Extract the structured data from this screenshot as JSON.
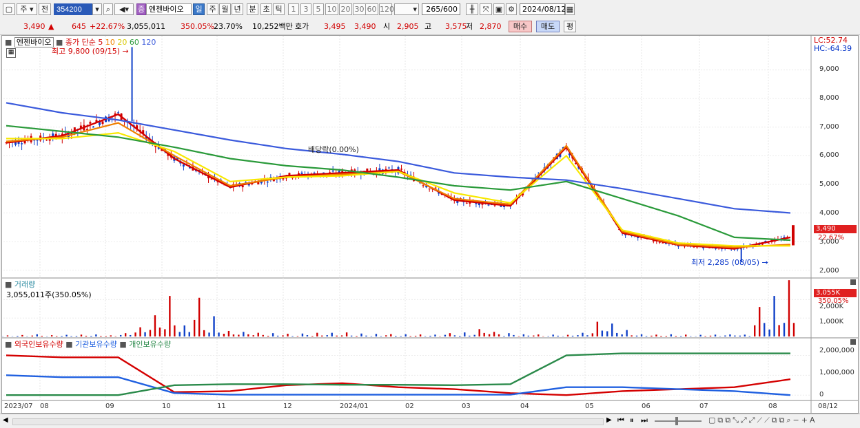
{
  "toolbar": {
    "market": "주",
    "prev": "전",
    "code": "354200",
    "stock_badge": "증",
    "stock_name": "엔젠바이오",
    "periods": [
      "일",
      "주",
      "월",
      "년",
      "분",
      "초",
      "틱"
    ],
    "intervals": [
      "1",
      "3",
      "5",
      "10",
      "20",
      "30",
      "60",
      "120"
    ],
    "count": "265",
    "count_total": "/600",
    "date": "2024/08/12"
  },
  "quote": {
    "price": "3,490",
    "change": "645",
    "change_pct": "+22.67%",
    "volume": "3,055,011",
    "volume_ratio": "350.05%",
    "turnover": "23.70%",
    "amount": "10,252백만",
    "bid_label": "호가",
    "ask": "3,495",
    "bid": "3,490",
    "open_label": "시",
    "open": "2,905",
    "high_label": "고",
    "high": "3,575",
    "low_label": "저",
    "low": "2,870",
    "buy_btn": "매수",
    "sell_btn": "매도",
    "eval_btn": "평"
  },
  "price_panel": {
    "name": "엔젠바이오",
    "legend_prefix": "종가 단순",
    "ma_periods": [
      "5",
      "10",
      "20",
      "60",
      "120"
    ],
    "lc": "LC:52.74",
    "hc": "HC:-64.39",
    "high_note": "최고 9,800 (09/15)",
    "low_note": "최저 2,285 (08/05)",
    "dividend_note": "배당락(0.00%)",
    "last_price": "3,490",
    "last_pct": "22.67%",
    "y_ticks": [
      "9,000",
      "8,000",
      "7,000",
      "6,000",
      "5,000",
      "4,000",
      "3,000",
      "2,000"
    ]
  },
  "volume_panel": {
    "title": "거래량",
    "value": "3,055,011주(350.05%)",
    "last_value": "3,055K",
    "last_pct": "350.05%",
    "y_ticks": [
      "2,000K",
      "1,000K"
    ]
  },
  "holding_panel": {
    "legend": [
      "외국인보유수량",
      "기관보유수량",
      "개인보유수량"
    ],
    "y_ticks": [
      "2,000,000",
      "1,000,000",
      "0"
    ]
  },
  "x_labels": [
    "2023/07",
    "08",
    "09",
    "10",
    "11",
    "12",
    "2024/01",
    "02",
    "03",
    "04",
    "05",
    "06",
    "07",
    "08",
    "08/12"
  ],
  "colors": {
    "ma5": "#d40000",
    "ma10": "#f08000",
    "ma20": "#f8e800",
    "ma60": "#2a9a3a",
    "ma120": "#3a5adc",
    "up": "#d00000",
    "down": "#1040c8",
    "foreign": "#d40000",
    "inst": "#2060e0",
    "indiv": "#2a8a4a"
  },
  "chart_data": [
    {
      "type": "line",
      "title": "엔젠바이오",
      "x": [
        "2023/07",
        "08",
        "09",
        "10",
        "11",
        "12",
        "2024/01",
        "02",
        "03",
        "04",
        "05",
        "06",
        "07",
        "08",
        "08/12"
      ],
      "series": [
        {
          "name": "5",
          "values": [
            6450,
            6700,
            7450,
            5900,
            4900,
            5300,
            5400,
            5500,
            4450,
            4250,
            6300,
            3300,
            2880,
            2750,
            3150
          ]
        },
        {
          "name": "10",
          "values": [
            6500,
            6650,
            7150,
            6000,
            4950,
            5250,
            5350,
            5450,
            4500,
            4300,
            6350,
            3350,
            2900,
            2800,
            2900
          ]
        },
        {
          "name": "20",
          "values": [
            6600,
            6600,
            6800,
            6150,
            5100,
            5250,
            5300,
            5450,
            4700,
            4350,
            6000,
            3400,
            2950,
            2850,
            2850
          ]
        },
        {
          "name": "60",
          "values": [
            7050,
            6850,
            6650,
            6300,
            5900,
            5650,
            5500,
            5250,
            4950,
            4800,
            5100,
            4500,
            3900,
            3150,
            3050
          ]
        },
        {
          "name": "120",
          "values": [
            7850,
            7500,
            7250,
            6900,
            6550,
            6250,
            6050,
            5800,
            5400,
            5250,
            5150,
            4850,
            4500,
            4150,
            4000
          ]
        }
      ],
      "ylim": [
        1800,
        10000
      ],
      "max_point": {
        "date": "09/15",
        "value": 9800
      },
      "min_point": {
        "date": "08/05",
        "value": 2285
      }
    },
    {
      "type": "bar",
      "title": "거래량",
      "ylim": [
        0,
        2800
      ],
      "values_k": [
        60,
        80,
        120,
        70,
        90,
        100,
        110,
        60,
        180,
        500,
        1150,
        2200,
        600,
        2100,
        1100,
        300,
        250,
        200,
        180,
        150,
        160,
        200,
        200,
        220,
        160,
        140,
        130,
        120,
        110,
        100,
        180,
        220,
        400,
        250,
        180,
        120,
        110,
        100,
        90,
        200,
        800,
        700,
        350,
        120,
        100,
        120,
        100,
        90,
        100,
        110,
        100,
        1600,
        2200,
        3055
      ],
      "up": [
        true,
        true,
        false,
        true,
        false,
        true,
        false,
        true,
        true,
        true,
        true,
        true,
        false,
        true,
        false,
        true,
        false,
        true,
        false,
        true,
        false,
        true,
        false,
        true,
        false,
        false,
        true,
        false,
        true,
        false,
        true,
        false,
        true,
        true,
        false,
        false,
        true,
        false,
        true,
        false,
        true,
        false,
        false,
        false,
        true,
        false,
        true,
        false,
        false,
        false,
        false,
        true,
        false,
        true
      ]
    },
    {
      "type": "line",
      "title": "보유수량",
      "x": [
        "2023/07",
        "08",
        "09",
        "10",
        "11",
        "12",
        "2024/01",
        "02",
        "03",
        "04",
        "05",
        "06",
        "07",
        "08",
        "08/12"
      ],
      "series": [
        {
          "name": "외국인보유수량",
          "values": [
            2000000,
            1900000,
            1900000,
            150000,
            200000,
            500000,
            600000,
            400000,
            300000,
            100000,
            0,
            200000,
            300000,
            400000,
            800000
          ]
        },
        {
          "name": "기관보유수량",
          "values": [
            1000000,
            900000,
            900000,
            100000,
            20000,
            20000,
            20000,
            20000,
            20000,
            20000,
            400000,
            400000,
            300000,
            200000,
            0
          ]
        },
        {
          "name": "개인보유수량",
          "values": [
            0,
            0,
            0,
            500000,
            550000,
            550000,
            520000,
            520000,
            500000,
            550000,
            2000000,
            2100000,
            2100000,
            2100000,
            2100000
          ]
        }
      ],
      "ylim": [
        -200000,
        2500000
      ]
    }
  ]
}
